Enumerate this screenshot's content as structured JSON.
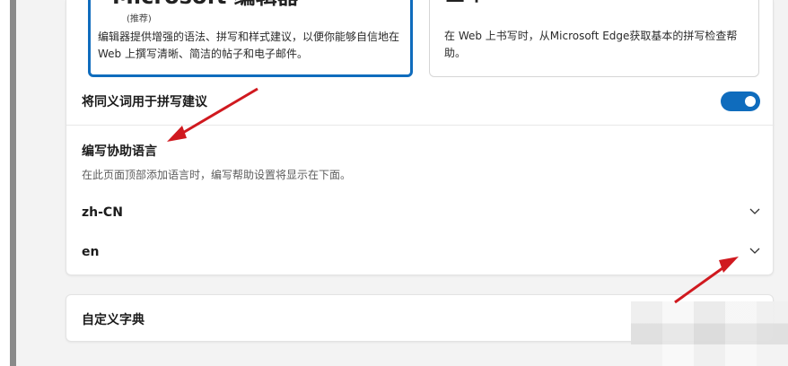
{
  "editor_option": {
    "title": "Microsoft 编辑器",
    "recommend": "(推荐)",
    "description": "编辑器提供增强的语法、拼写和样式建议，以便你能够自信地在 Web 上撰写清晰、简洁的帖子和电子邮件。"
  },
  "basic_option": {
    "title": "基本",
    "description": "在 Web 上书写时，从Microsoft Edge获取基本的拼写检查帮助。"
  },
  "synonym_toggle": {
    "label": "将同义词用于拼写建议",
    "state": "on"
  },
  "writing_languages": {
    "title": "编写协助语言",
    "description": "在此页面顶部添加语言时，编写帮助设置将显示在下面。",
    "items": [
      {
        "label": "zh-CN"
      },
      {
        "label": "en"
      }
    ]
  },
  "custom_dictionary": {
    "label": "自定义字典"
  },
  "colors": {
    "accent": "#0f6cbd",
    "annotation_arrow": "#d0191f"
  }
}
